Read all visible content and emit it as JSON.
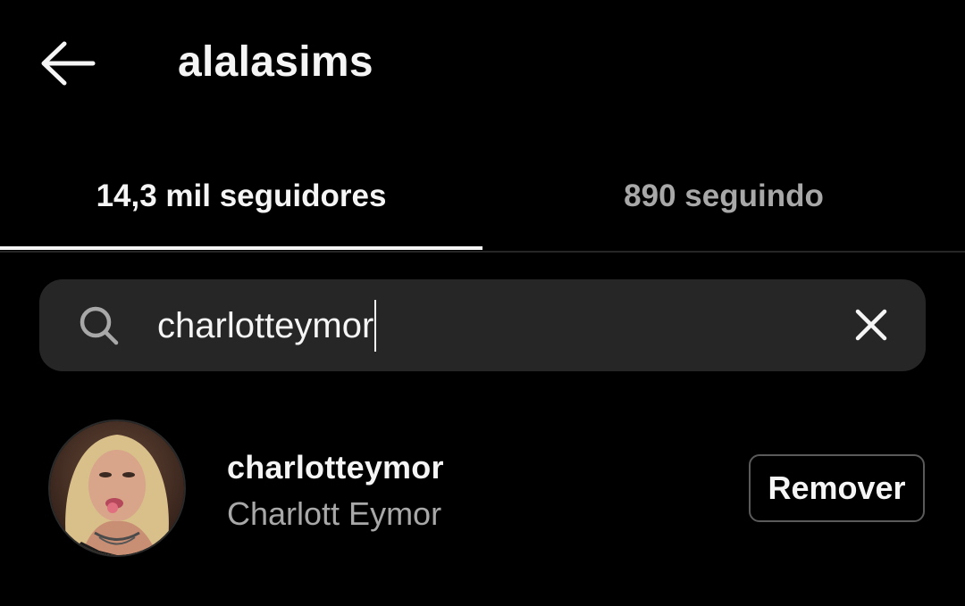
{
  "header": {
    "back_icon": "arrow-left-icon",
    "title": "alalasims"
  },
  "tabs": [
    {
      "label": "14,3 mil seguidores",
      "active": true
    },
    {
      "label": "890 seguindo",
      "active": false
    }
  ],
  "search": {
    "icon": "search-icon",
    "value": "charlotteymor",
    "clear_icon": "close-icon"
  },
  "results": [
    {
      "username": "charlotteymor",
      "full_name": "Charlott Eymor",
      "avatar": "avatar-photo",
      "action_label": "Remover"
    }
  ],
  "colors": {
    "background": "#000000",
    "primary_text": "#f5f5f5",
    "secondary_text": "#a8a8a8",
    "search_bg": "#262626",
    "button_border": "#5a5a5a"
  }
}
